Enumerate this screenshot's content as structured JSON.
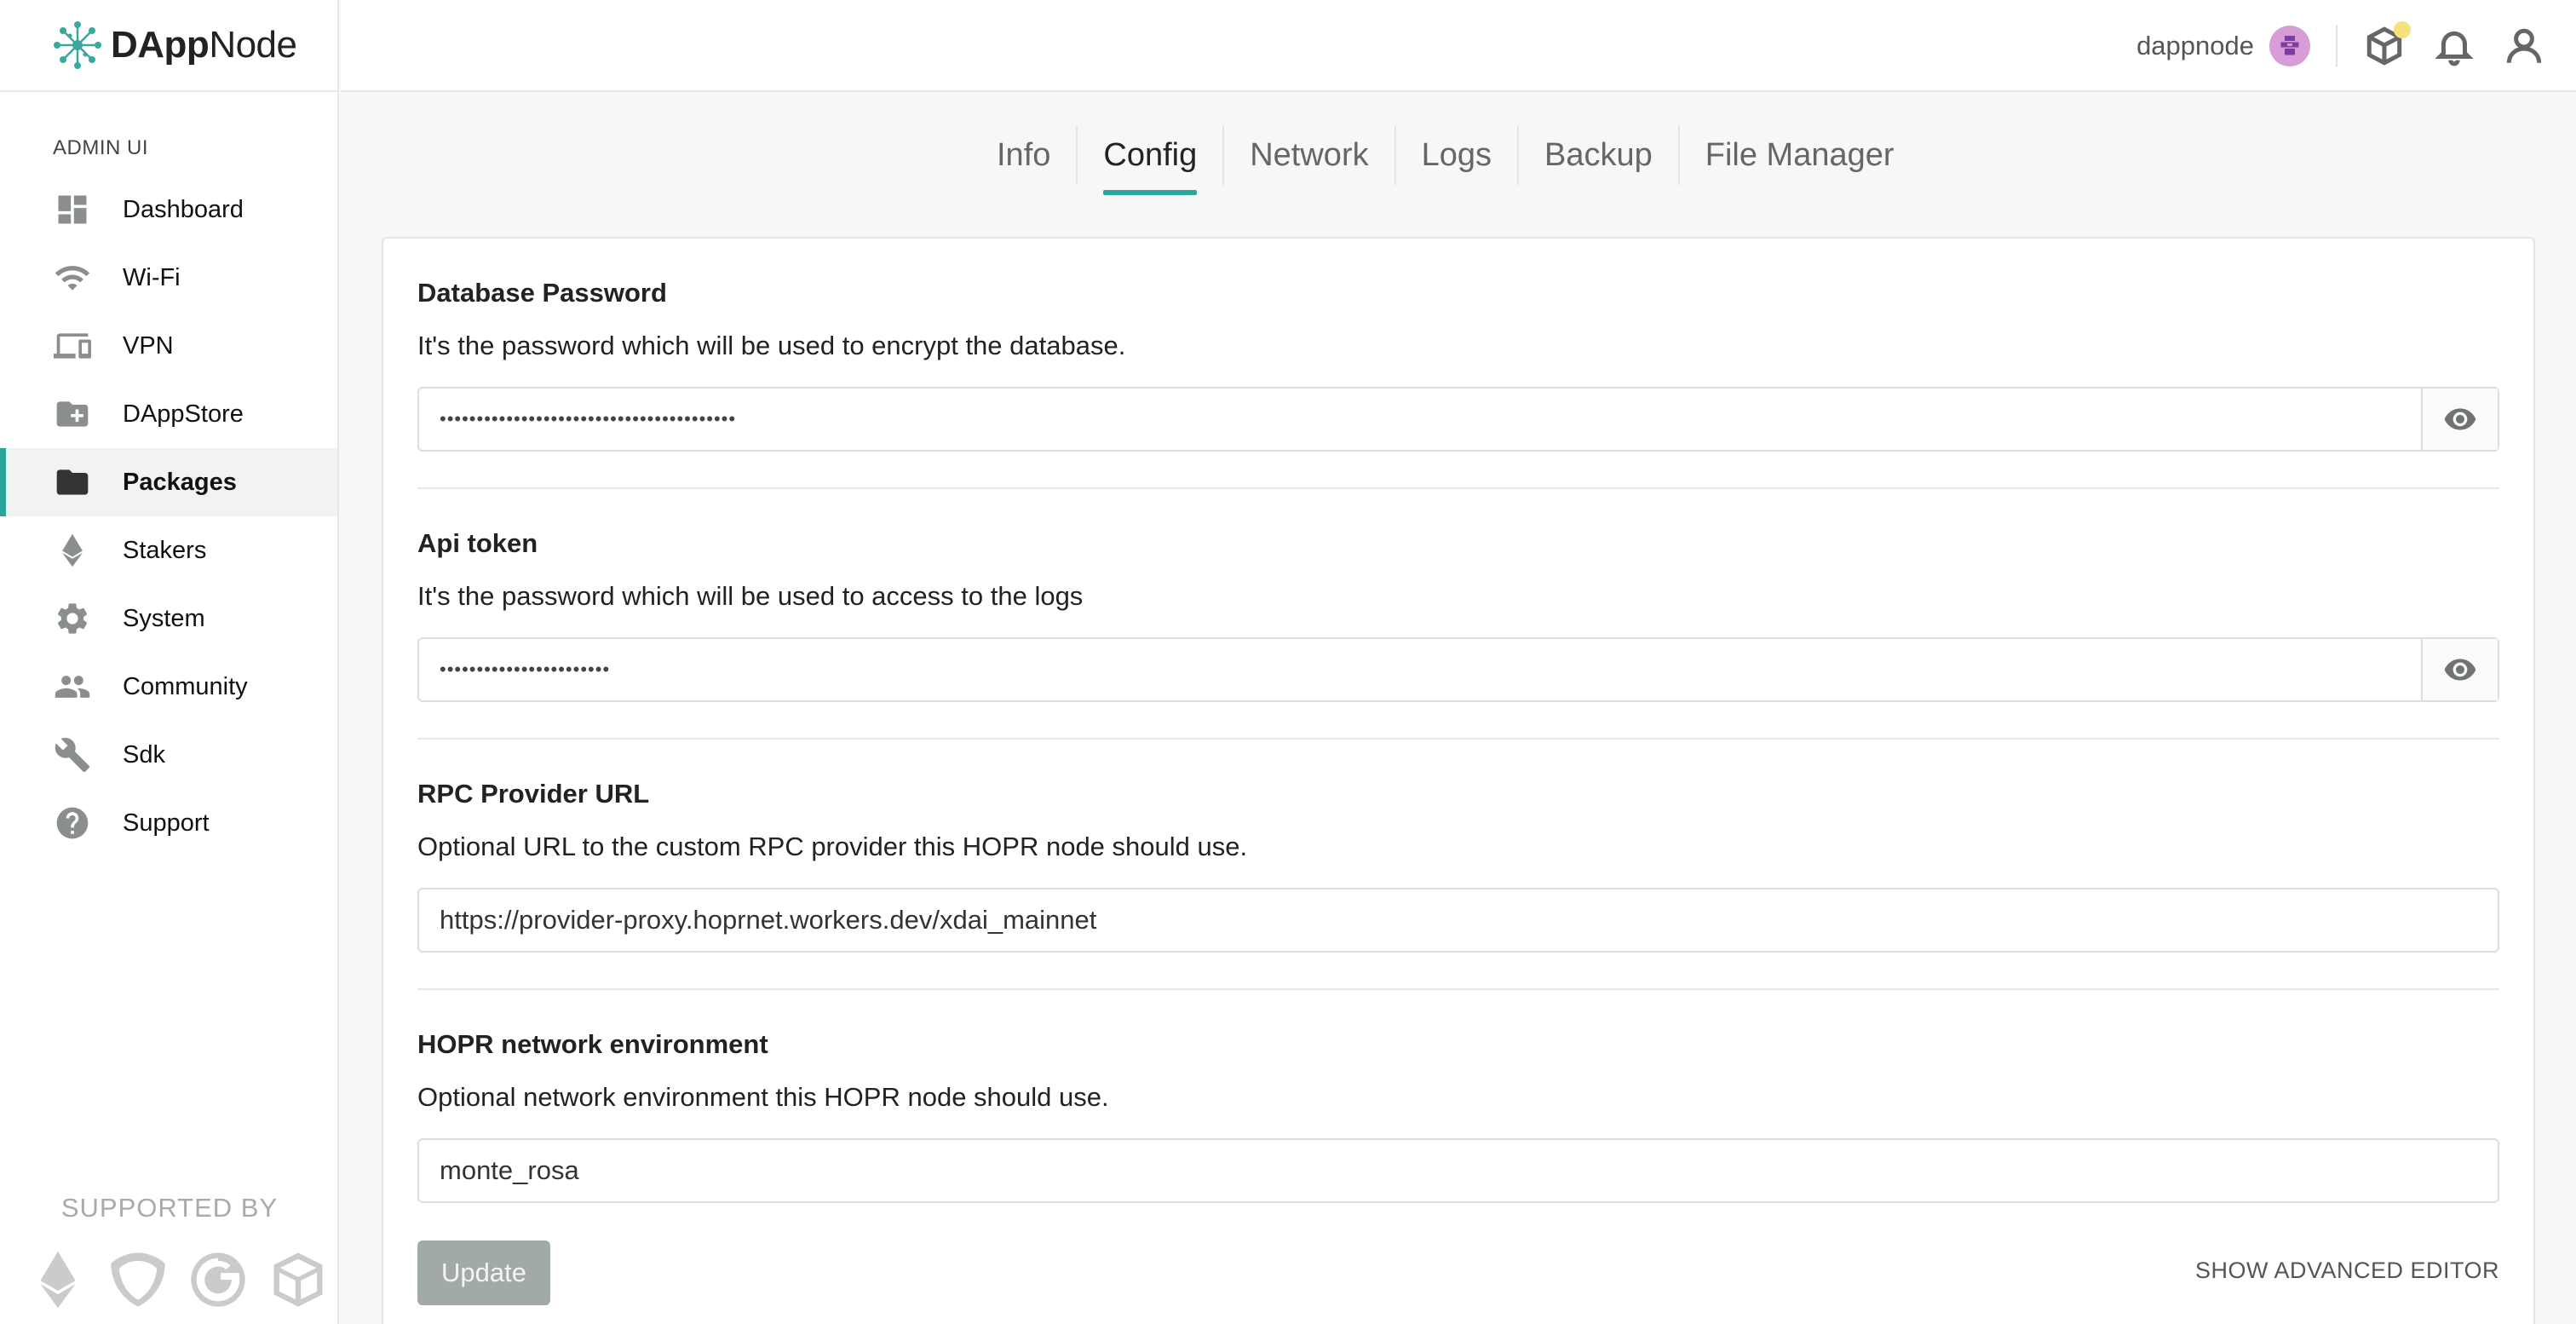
{
  "brand": {
    "name_bold": "DApp",
    "name_rest": "Node"
  },
  "sidebar": {
    "section_label": "ADMIN UI",
    "items": [
      {
        "label": "Dashboard",
        "icon": "dashboard-icon"
      },
      {
        "label": "Wi-Fi",
        "icon": "wifi-icon"
      },
      {
        "label": "VPN",
        "icon": "devices-icon"
      },
      {
        "label": "DAppStore",
        "icon": "folder-plus-icon"
      },
      {
        "label": "Packages",
        "icon": "folder-icon",
        "active": true
      },
      {
        "label": "Stakers",
        "icon": "ethereum-icon"
      },
      {
        "label": "System",
        "icon": "gear-icon"
      },
      {
        "label": "Community",
        "icon": "people-icon"
      },
      {
        "label": "Sdk",
        "icon": "wrench-icon"
      },
      {
        "label": "Support",
        "icon": "help-icon"
      }
    ],
    "supported_by": "SUPPORTED BY"
  },
  "header": {
    "username": "dappnode",
    "icons": [
      "avatar-icon",
      "package-cube-icon",
      "bell-icon",
      "user-icon"
    ]
  },
  "tabs": [
    {
      "label": "Info"
    },
    {
      "label": "Config",
      "active": true
    },
    {
      "label": "Network"
    },
    {
      "label": "Logs"
    },
    {
      "label": "Backup"
    },
    {
      "label": "File Manager"
    }
  ],
  "config": {
    "fields": [
      {
        "title": "Database Password",
        "description": "It's the password which will be used to encrypt the database.",
        "value": "••••••••••••••••••••••••••••••••••••••••",
        "type": "password"
      },
      {
        "title": "Api token",
        "description": "It's the password which will be used to access to the logs",
        "value": "•••••••••••••••••••••••",
        "type": "password"
      },
      {
        "title": "RPC Provider URL",
        "description": "Optional URL to the custom RPC provider this HOPR node should use.",
        "value": "https://provider-proxy.hoprnet.workers.dev/xdai_mainnet",
        "type": "text"
      },
      {
        "title": "HOPR network environment",
        "description": "Optional network environment this HOPR node should use.",
        "value": "monte_rosa",
        "type": "text"
      }
    ],
    "update_label": "Update",
    "advanced_label": "SHOW ADVANCED EDITOR"
  },
  "colors": {
    "accent": "#2aa59a",
    "update_button": "#a2aaa8",
    "notification_dot": "#f5e27a"
  }
}
